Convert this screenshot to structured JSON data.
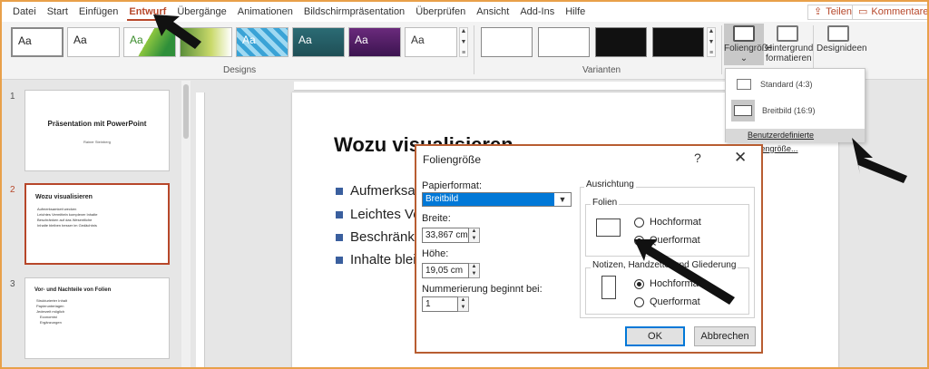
{
  "menu": {
    "tabs": [
      "Datei",
      "Start",
      "Einfügen",
      "Entwurf",
      "Übergänge",
      "Animationen",
      "Bildschirmpräsentation",
      "Überprüfen",
      "Ansicht",
      "Add-Ins",
      "Hilfe"
    ],
    "active": "Entwurf",
    "share": "Teilen",
    "comments": "Kommentare"
  },
  "ribbon": {
    "designs_label": "Designs",
    "variants_label": "Varianten",
    "theme_sample": "Aa",
    "slide_size": "Foliengröße",
    "format_background_line1": "Hintergrund",
    "format_background_line2": "formatieren",
    "design_ideas": "Designideen",
    "chevron": "⌄"
  },
  "slides": [
    {
      "number": "1",
      "title": "Präsentation mit PowerPoint",
      "subtitle": "Rainer Steinberg"
    },
    {
      "number": "2",
      "title": "Wozu visualisieren",
      "bullets": [
        "Aufmerksamkeit wecken",
        "Leichtes Vermitteln komplexer Inhalte",
        "Beschränken auf das Wesentliche",
        "Inhalte bleiben besser im Gedächtnis"
      ]
    },
    {
      "number": "3",
      "title": "Vor- und Nachteile von Folien",
      "bullets": [
        "Strukturierter Inhalt",
        "Papierunterlagen",
        "Jederzeit möglich",
        "Economist",
        "Ergänzungen"
      ]
    }
  ],
  "slide": {
    "title": "Wozu visualisieren",
    "bullets": [
      "Aufmerksa",
      "Leichtes Ve",
      "Beschränke",
      "Inhalte blei"
    ]
  },
  "dropdown": {
    "standard": "Standard (4:3)",
    "widescreen": "Breitbild (16:9)",
    "custom": "Benutzerdefinierte Foliengröße..."
  },
  "dialog": {
    "title": "Foliengröße",
    "help": "?",
    "close": "✕",
    "paper_label": "Papierformat:",
    "paper_value": "Breitbild",
    "width_label": "Breite:",
    "width_value": "33,867 cm",
    "height_label": "Höhe:",
    "height_value": "19,05 cm",
    "numbering_label": "Nummerierung beginnt bei:",
    "numbering_value": "1",
    "orientation_label": "Ausrichtung",
    "slides_label": "Folien",
    "portrait": "Hochformat",
    "landscape": "Querformat",
    "notes_label": "Notizen, Handzettel und Gliederung",
    "ok": "OK",
    "cancel": "Abbrechen"
  }
}
